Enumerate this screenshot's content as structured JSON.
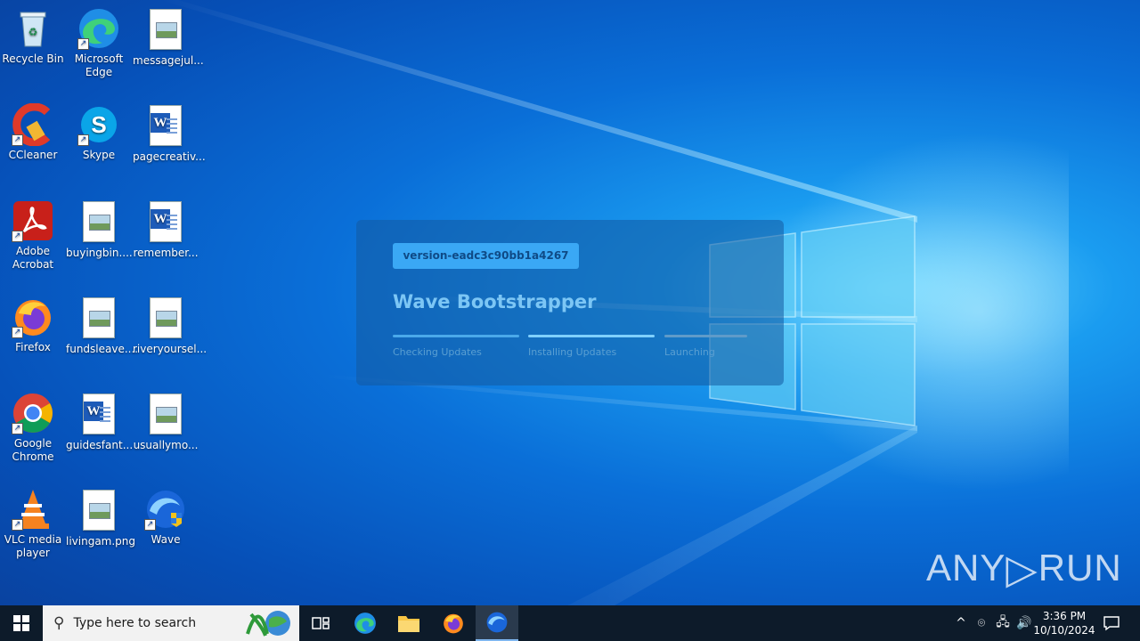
{
  "desktop": {
    "icons": [
      {
        "label": "Recycle Bin",
        "icon": "recycle-bin-icon"
      },
      {
        "label": "Microsoft Edge",
        "icon": "edge-icon"
      },
      {
        "label": "messagejul...",
        "icon": "image-file-icon"
      },
      {
        "label": "CCleaner",
        "icon": "ccleaner-icon"
      },
      {
        "label": "Skype",
        "icon": "skype-icon"
      },
      {
        "label": "pagecreativ...",
        "icon": "word-document-icon"
      },
      {
        "label": "Adobe Acrobat",
        "icon": "acrobat-icon"
      },
      {
        "label": "buyingbin....",
        "icon": "image-file-icon"
      },
      {
        "label": "remember...",
        "icon": "word-document-icon"
      },
      {
        "label": "Firefox",
        "icon": "firefox-icon"
      },
      {
        "label": "fundsleave....",
        "icon": "image-file-icon"
      },
      {
        "label": "riveryoursel...",
        "icon": "image-file-icon"
      },
      {
        "label": "Google Chrome",
        "icon": "chrome-icon"
      },
      {
        "label": "guidesfant...",
        "icon": "word-document-icon"
      },
      {
        "label": "usuallymo...",
        "icon": "image-file-icon"
      },
      {
        "label": "VLC media player",
        "icon": "vlc-icon"
      },
      {
        "label": "livingam.png",
        "icon": "image-file-icon"
      },
      {
        "label": "Wave",
        "icon": "wave-icon"
      }
    ]
  },
  "bootstrapper": {
    "version": "version-eadc3c90bb1a4267",
    "title": "Wave Bootstrapper",
    "steps": [
      {
        "label": "Checking Updates",
        "state": "done"
      },
      {
        "label": "Installing Updates",
        "state": "active"
      },
      {
        "label": "Launching",
        "state": "pending"
      }
    ]
  },
  "watermark": {
    "left": "ANY",
    "right": "RUN"
  },
  "taskbar": {
    "search_placeholder": "Type here to search",
    "time": "3:36 PM",
    "date": "10/10/2024"
  },
  "colors": {
    "taskbar": "#0d1b2a",
    "dialog_pill": "#3aa8f5",
    "dialog_title": "#7cc6f5"
  }
}
